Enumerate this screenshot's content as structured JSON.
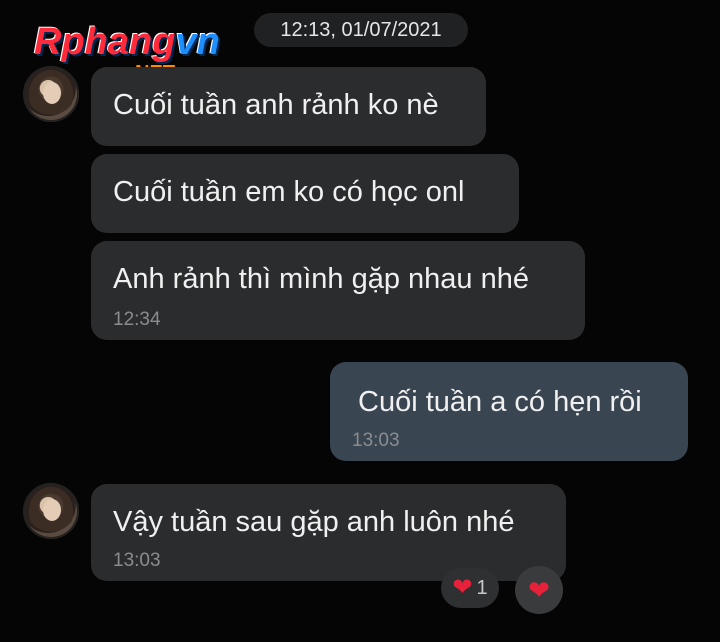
{
  "watermark": {
    "brand": "Rphangvn",
    "brand_part1": "Rphang",
    "brand_part2": "vn",
    "tld": ".NET"
  },
  "header": {
    "timestamp": "12:13, 01/07/2021"
  },
  "messages": [
    {
      "sender": "other",
      "text": "Cuối tuần anh rảnh ko nè"
    },
    {
      "sender": "other",
      "text": "Cuối tuần em ko có học onl"
    },
    {
      "sender": "other",
      "text": "Anh rảnh thì mình gặp nhau nhé",
      "time": "12:34"
    },
    {
      "sender": "me",
      "text": "Cuối tuần a có hẹn rồi",
      "time": "13:03"
    },
    {
      "sender": "other",
      "text": "Vậy tuần sau gặp anh luôn nhé",
      "time": "13:03"
    }
  ],
  "reactions": {
    "count_label": "1",
    "icon": "heart-icon",
    "add_icon": "heart-icon",
    "color": "#e8213b"
  },
  "colors": {
    "background": "#050505",
    "incoming_bubble": "#2b2c2e",
    "outgoing_bubble": "#3a4552"
  }
}
